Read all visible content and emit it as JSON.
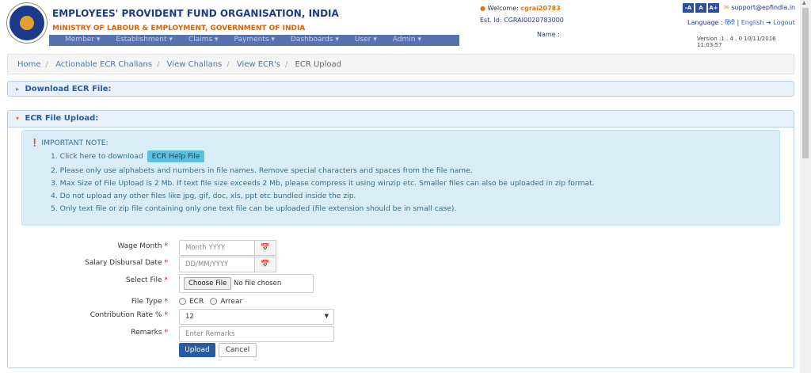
{
  "header": {
    "org_title": "EMPLOYEES' PROVIDENT FUND ORGANISATION, INDIA",
    "ministry": "MINISTRY OF LABOUR & EMPLOYMENT, GOVERNMENT OF INDIA",
    "welcome_label": "Welcome:",
    "username": "cgrai20783",
    "est_id": "Est. Id: CGRAI0020783000",
    "name_label": "Name :",
    "font_buttons": [
      "-A",
      "A",
      "A+"
    ],
    "support_email": "support@epfindia.in",
    "language_label": "Language :",
    "lang_hindi": "हिंदी",
    "lang_english": "English",
    "logout": "Logout",
    "version": "Version :1 . 4 . 0 10/11/2016 11:03:57"
  },
  "nav": {
    "items": [
      "Member ▾",
      "Establishment ▾",
      "Claims ▾",
      "Payments ▾",
      "Dashboards ▾",
      "User ▾",
      "Admin ▾"
    ]
  },
  "breadcrumb": {
    "items": [
      "Home",
      "Actionable ECR Challans",
      "View Challans",
      "View ECR's"
    ],
    "current": "ECR Upload"
  },
  "panels": {
    "download_title": "Download ECR File:",
    "upload_title": "ECR File Upload:"
  },
  "note": {
    "heading": "IMPORTANT NOTE:",
    "line1_prefix": "1. Click here to download",
    "help_button": "ECR Help File",
    "line2": "2. Please only use alphabets and numbers in file names. Remove special characters and spaces from the file name.",
    "line3": "3. Max Size of File Upload is 2 Mb. If text file size exceeds 2 Mb, please compress it using winzip etc. Smaller files can also be uploaded in zip format.",
    "line4": "4. Do not upload any other files like jpg, gif, doc, xls, ppt etc bundled inside the zip.",
    "line5": "5. Only text file or zip file containing only one text file can be uploaded (file extension should be in small case)."
  },
  "form": {
    "wage_month_label": "Wage Month",
    "wage_month_placeholder": "Month YYYY",
    "salary_date_label": "Salary Disbursal Date",
    "salary_date_placeholder": "DD/MM/YYYY",
    "select_file_label": "Select File",
    "choose_file": "Choose File",
    "no_file": "No file chosen",
    "file_type_label": "File Type",
    "file_type_options": [
      "ECR",
      "Arrear"
    ],
    "contribution_label": "Contribution Rate %",
    "contribution_value": "12",
    "remarks_label": "Remarks",
    "remarks_placeholder": "Enter Remarks",
    "required_mark": "*",
    "upload_button": "Upload",
    "cancel_button": "Cancel"
  },
  "icons": {
    "calendar": "calendar-icon",
    "info": "info-icon",
    "user": "user-icon",
    "mail": "mail-icon"
  }
}
